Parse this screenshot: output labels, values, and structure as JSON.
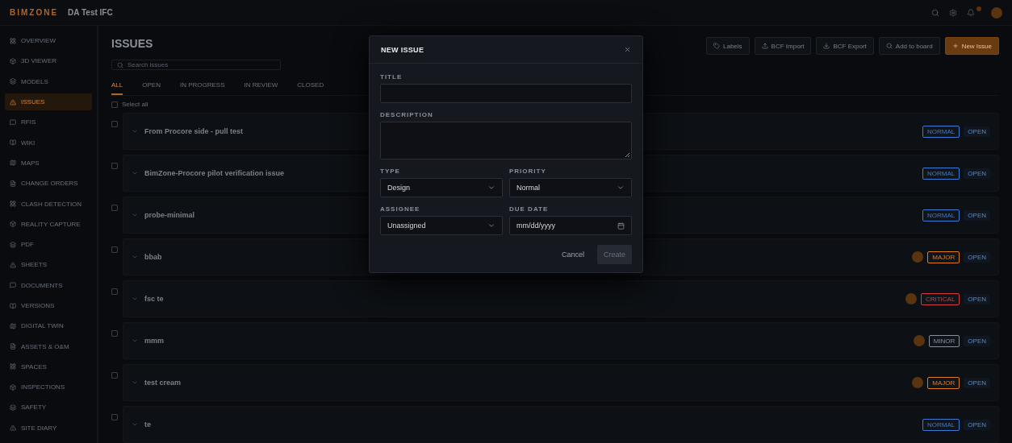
{
  "header": {
    "logo": "BIMZONE",
    "project": "DA Test IFC",
    "notifications": true
  },
  "sidebar": {
    "items": [
      {
        "label": "OVERVIEW",
        "selected": false
      },
      {
        "label": "3D VIEWER",
        "selected": false
      },
      {
        "label": "MODELS",
        "selected": false
      },
      {
        "label": "ISSUES",
        "selected": true
      },
      {
        "label": "RFIS",
        "selected": false
      },
      {
        "label": "WIKI",
        "selected": false
      },
      {
        "label": "MAPS",
        "selected": false
      },
      {
        "label": "CHANGE ORDERS",
        "selected": false
      },
      {
        "label": "CLASH DETECTION",
        "selected": false
      },
      {
        "label": "REALITY CAPTURE",
        "selected": false
      },
      {
        "label": "PDF",
        "selected": false
      },
      {
        "label": "SHEETS",
        "selected": false
      },
      {
        "label": "DOCUMENTS",
        "selected": false
      },
      {
        "label": "VERSIONS",
        "selected": false
      },
      {
        "label": "DIGITAL TWIN",
        "selected": false
      },
      {
        "label": "ASSETS & O&M",
        "selected": false
      },
      {
        "label": "SPACES",
        "selected": false
      },
      {
        "label": "INSPECTIONS",
        "selected": false
      },
      {
        "label": "SAFETY",
        "selected": false
      },
      {
        "label": "SITE DIARY",
        "selected": false
      }
    ]
  },
  "page": {
    "title": "ISSUES",
    "search": {
      "placeholder": "Search issues"
    },
    "actions": [
      {
        "label": "Labels",
        "kind": "plain"
      },
      {
        "label": "BCF Import",
        "kind": "plain"
      },
      {
        "label": "BCF Export",
        "kind": "plain"
      },
      {
        "label": "Add to board",
        "kind": "plain"
      },
      {
        "label": "New Issue",
        "kind": "primary"
      }
    ],
    "tabs": [
      {
        "label": "ALL",
        "selected": true
      },
      {
        "label": "OPEN",
        "selected": false
      },
      {
        "label": "IN PROGRESS",
        "selected": false
      },
      {
        "label": "IN REVIEW",
        "selected": false
      },
      {
        "label": "CLOSED",
        "selected": false
      }
    ],
    "select_all": {
      "label": "Select all",
      "checked": false
    },
    "rows": [
      {
        "title": "From Procore side - pull test",
        "priority": "NORMAL",
        "color": "#3a7bd5",
        "status": "OPEN",
        "assigned": false,
        "checked": false
      },
      {
        "title": "BimZone-Procore pilot verification issue",
        "priority": "NORMAL",
        "color": "#3a7bd5",
        "status": "OPEN",
        "assigned": false,
        "checked": false
      },
      {
        "title": "probe-minimal",
        "priority": "NORMAL",
        "color": "#3a7bd5",
        "status": "OPEN",
        "assigned": false,
        "checked": false
      },
      {
        "title": "bbab",
        "priority": "MAJOR",
        "color": "#e07a1f",
        "status": "OPEN",
        "assigned": true,
        "checked": false
      },
      {
        "title": "fsc te",
        "priority": "CRITICAL",
        "color": "#d63b3b",
        "status": "OPEN",
        "assigned": true,
        "checked": false
      },
      {
        "title": "mmm",
        "priority": "MINOR",
        "color": "#8a8f98",
        "status": "OPEN",
        "assigned": true,
        "checked": false
      },
      {
        "title": "test cream",
        "priority": "MAJOR",
        "color": "#e07a1f",
        "status": "OPEN",
        "assigned": true,
        "checked": false
      },
      {
        "title": "te",
        "priority": "NORMAL",
        "color": "#3a7bd5",
        "status": "OPEN",
        "assigned": false,
        "checked": false
      }
    ]
  },
  "dialog": {
    "title": "NEW ISSUE",
    "fields": [
      {
        "label": "TITLE",
        "kind": "text"
      },
      {
        "label": "DESCRIPTION",
        "kind": "textarea"
      },
      {
        "label": "TYPE",
        "kind": "select",
        "value": "Design"
      },
      {
        "label": "PRIORITY",
        "kind": "select",
        "value": "Normal"
      },
      {
        "label": "ASSIGNEE",
        "kind": "select",
        "value": "Unassigned"
      },
      {
        "label": "DUE DATE",
        "kind": "date",
        "value": "mm/dd/yyyy"
      }
    ],
    "cancel": "Cancel",
    "create": {
      "label": "Create",
      "disabled": true
    }
  }
}
